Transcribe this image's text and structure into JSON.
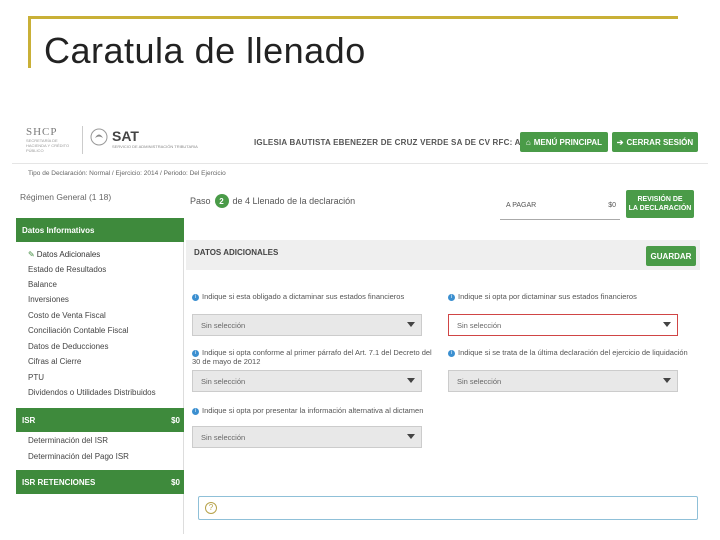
{
  "slide": {
    "title": "Caratula de llenado"
  },
  "header": {
    "logo_shcp": "SHCP",
    "logo_shcp_sub": "SECRETARÍA DE HACIENDA Y CRÉDITO PÚBLICO",
    "logo_sat": "SAT",
    "logo_sat_sub": "SERVICIO DE ADMINISTRACIÓN TRIBUTARIA",
    "taxpayer": "IGLESIA BAUTISTA EBENEZER DE CRUZ VERDE SA DE CV RFC: ACA040629515",
    "menu_label": "MENÚ PRINCIPAL",
    "logout_label": "CERRAR SESIÓN"
  },
  "breadcrumb": "Tipo de Declaración: Normal / Ejercicio: 2014 / Periodo: Del Ejercicio",
  "regimen": "Régimen General (1 18)",
  "step": {
    "prefix": "Paso",
    "current": "2",
    "suffix": "de 4 Llenado de la declaración"
  },
  "payment": {
    "label": "A PAGAR",
    "value": "$0"
  },
  "review_button": {
    "line1": "REVISIÓN DE",
    "line2": "LA DECLARACIÓN"
  },
  "sidebar": {
    "sections": [
      {
        "label": "Datos Informativos",
        "amount": ""
      },
      {
        "label": "ISR",
        "amount": "$0"
      },
      {
        "label": "ISR RETENCIONES",
        "amount": "$0"
      }
    ],
    "informativos_items": [
      "Datos Adicionales",
      "Estado de Resultados",
      "Balance",
      "Inversiones",
      "Costo de Venta Fiscal",
      "Conciliación Contable Fiscal",
      "Datos de Deducciones",
      "Cifras al Cierre",
      "PTU",
      "Dividendos o Utilidades Distribuidos"
    ],
    "isr_items": [
      "Determinación del ISR",
      "Determinación del Pago ISR"
    ]
  },
  "section": {
    "title": "DATOS ADICIONALES",
    "save_label": "GUARDAR"
  },
  "questions": [
    "Indique si esta obligado a dictaminar sus estados financieros",
    "Indique si opta por dictaminar sus estados financieros",
    "Indique si opta conforme al primer párrafo del Art. 7.1 del Decreto del 30 de mayo de 2012",
    "Indique si se trata de la última declaración del ejercicio de liquidación",
    "Indique si opta por presentar la información alternativa al dictamen"
  ],
  "select_placeholder": "Sin selección",
  "colors": {
    "accent_green": "#4a9b48",
    "sidebar_green": "#3e8a3c",
    "error_red": "#d04545",
    "frame_gold": "#c9b037"
  }
}
